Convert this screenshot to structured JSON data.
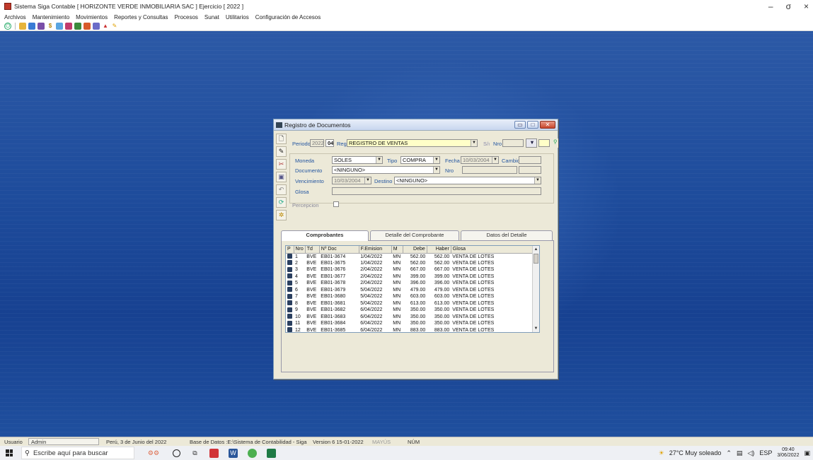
{
  "app": {
    "title": "Sistema Siga Contable [ HORIZONTE VERDE INMOBILIARIA SAC ] Ejercicio [ 2022 ]",
    "window_controls": [
      "–",
      "σ",
      "×"
    ],
    "menu": [
      "Archivos",
      "Mantenimiento",
      "Movimientos",
      "Reportes y Consultas",
      "Procesos",
      "Sunat",
      "Utilitarios",
      "Configuración de Accesos"
    ]
  },
  "dialog": {
    "title": "Registro de Documentos",
    "periodo_label": "Periodo",
    "periodo_year": "2022",
    "periodo_month": "04",
    "reg_label": "Reg",
    "reg_value": "REGISTRO DE VENTAS",
    "sc_label": "S/ı",
    "nro_label": "Nro",
    "moneda_label": "Moneda",
    "moneda_value": "SOLES",
    "tipo_label": "Tipo",
    "tipo_value": "COMPRA",
    "fecha_label": "Fecha",
    "fecha_value": "10/03/2004",
    "cambio_label": "Cambio",
    "documento_label": "Documento",
    "documento_value": "<NINGUNO>",
    "nro2_label": "Nro",
    "vencimiento_label": "Vencimiento",
    "vencimiento_value": "10/03/2004",
    "destino_label": "Destino",
    "destino_value": "<NINGUNO>",
    "glosa_label": "Glosa",
    "percepcion_label": "Percepcion",
    "tabs": [
      "Comprobantes",
      "Detalle del Comprobante",
      "Datos del Detalle"
    ],
    "grid": {
      "columns": [
        "P",
        "Nro",
        "Td",
        "Nº Doc",
        "F.Emision",
        "M",
        "Debe",
        "Haber",
        "Glosa"
      ],
      "rows": [
        [
          "1",
          "BVE",
          "EB01-3674",
          "1/04/2022",
          "MN",
          "562.00",
          "562.00",
          "VENTA DE LOTES"
        ],
        [
          "2",
          "BVE",
          "EB01-3675",
          "1/04/2022",
          "MN",
          "562.00",
          "562.00",
          "VENTA DE LOTES"
        ],
        [
          "3",
          "BVE",
          "EB01-3676",
          "2/04/2022",
          "MN",
          "667.00",
          "667.00",
          "VENTA DE LOTES"
        ],
        [
          "4",
          "BVE",
          "EB01-3677",
          "2/04/2022",
          "MN",
          "399.00",
          "399.00",
          "VENTA DE LOTES"
        ],
        [
          "5",
          "BVE",
          "EB01-3678",
          "2/04/2022",
          "MN",
          "396.00",
          "396.00",
          "VENTA DE LOTES"
        ],
        [
          "6",
          "BVE",
          "EB01-3679",
          "5/04/2022",
          "MN",
          "479.00",
          "479.00",
          "VENTA DE LOTES"
        ],
        [
          "7",
          "BVE",
          "EB01-3680",
          "5/04/2022",
          "MN",
          "603.00",
          "603.00",
          "VENTA DE LOTES"
        ],
        [
          "8",
          "BVE",
          "EB01-3681",
          "5/04/2022",
          "MN",
          "613.00",
          "613.00",
          "VENTA DE LOTES"
        ],
        [
          "9",
          "BVE",
          "EB01-3682",
          "6/04/2022",
          "MN",
          "350.00",
          "350.00",
          "VENTA DE LOTES"
        ],
        [
          "10",
          "BVE",
          "EB01-3683",
          "6/04/2022",
          "MN",
          "350.00",
          "350.00",
          "VENTA DE LOTES"
        ],
        [
          "11",
          "BVE",
          "EB01-3684",
          "6/04/2022",
          "MN",
          "350.00",
          "350.00",
          "VENTA DE LOTES"
        ],
        [
          "12",
          "BVE",
          "EB01-3685",
          "6/04/2022",
          "MN",
          "883.00",
          "883.00",
          "VENTA DE LOTES"
        ]
      ]
    }
  },
  "status": {
    "usuario_label": "Usuario",
    "usuario_value": "Admin",
    "date": "Perú, 3 de Junio del 2022",
    "db": "Base de Datos :E:\\Sistema de Contabilidad - Siga",
    "version": "Version 6 15-01-2022",
    "mayus": "MAYÚS",
    "num": "NÚM"
  },
  "taskbar": {
    "search_placeholder": "Escribe aquí para buscar",
    "weather": "27°C  Muy soleado",
    "lang": "ESP",
    "time": "09:40",
    "date": "3/06/2022"
  },
  "colors": {
    "desktop": "#1e4c9c",
    "dialog_bg": "#ece9d8",
    "label_blue": "#2355a0",
    "highlight_yellow": "#ffffc8"
  }
}
